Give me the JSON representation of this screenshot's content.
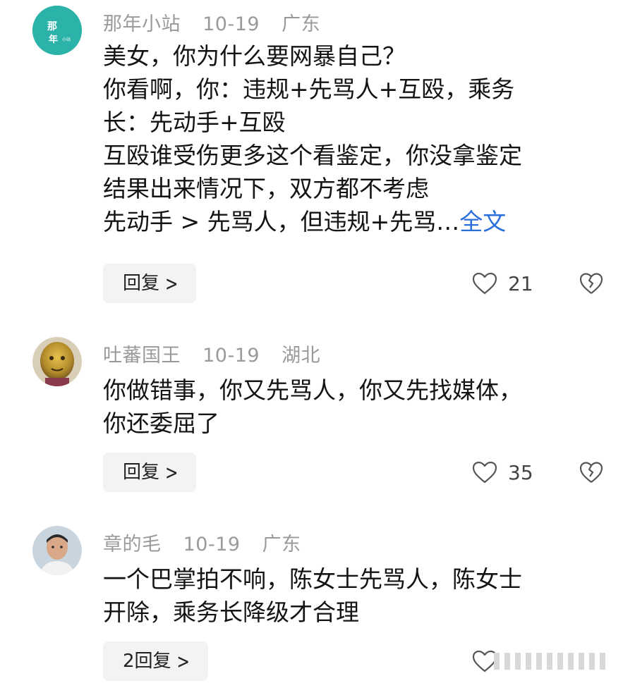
{
  "comments": [
    {
      "username": "那年小站",
      "date": "10-19",
      "location": "广东",
      "avatar_text": "那年",
      "avatar_color": "#2bb3a9",
      "lines": [
        "美女，你为什么要网暴自己？",
        "你看啊，你：违规+先骂人+互殴，乘务",
        "长：先动手+互殴",
        "互殴谁受伤更多这个看鉴定，你没拿鉴定",
        "结果出来情况下，双方都不考虑",
        "先动手 > 先骂人，但违规+先骂…"
      ],
      "more_label": "全文",
      "reply_label": "回复",
      "likes": "21"
    },
    {
      "username": "吐蕃国王",
      "date": "10-19",
      "location": "湖北",
      "avatar_color": "#c9a23a",
      "lines": [
        "你做错事，你又先骂人，你又先找媒体，",
        "你还委屈了"
      ],
      "reply_label": "回复",
      "likes": "35"
    },
    {
      "username": "章的毛",
      "date": "10-19",
      "location": "广东",
      "avatar_color": "#8a94a0",
      "lines": [
        "一个巴掌拍不响，陈女士先骂人，陈女士",
        "开除，乘务长降级才合理"
      ],
      "reply_label": "2回复",
      "likes": ""
    }
  ],
  "icons": {
    "like": "heart-outline-icon",
    "dislike": "broken-heart-icon",
    "chevron": "chevron-right-icon"
  }
}
